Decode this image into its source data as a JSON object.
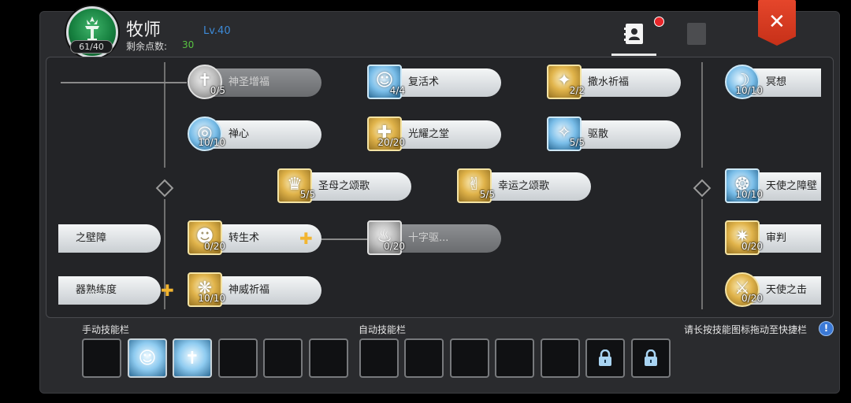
{
  "header": {
    "class_name": "牧师",
    "level": "Lv.40",
    "points_label": "剩余点数:",
    "points_value": "30",
    "avatar_badge": "61/40"
  },
  "close_label": "✕",
  "skills": [
    {
      "id": "shenshengzengfu",
      "name": "神圣增福",
      "level": "0/5",
      "style": "grey"
    },
    {
      "id": "fuhuoshu",
      "name": "复活术",
      "level": "4/4",
      "style": "blue"
    },
    {
      "id": "sashuiqifu",
      "name": "撒水祈福",
      "level": "2/2",
      "style": "gold"
    },
    {
      "id": "mingxiang",
      "name": "冥想",
      "level": "10/10",
      "style": "blue"
    },
    {
      "id": "chanxin",
      "name": "禅心",
      "level": "10/10",
      "style": "blue"
    },
    {
      "id": "guangyaozhitang",
      "name": "光耀之堂",
      "level": "20/20",
      "style": "gold"
    },
    {
      "id": "qusan",
      "name": "驱散",
      "level": "5/5",
      "style": "blue"
    },
    {
      "id": "shengmuzhisongge",
      "name": "圣母之颂歌",
      "level": "5/5",
      "style": "gold"
    },
    {
      "id": "xingyunzhisongge",
      "name": "幸运之颂歌",
      "level": "5/5",
      "style": "gold"
    },
    {
      "id": "tianshizhizhangbi",
      "name": "天使之障壁",
      "level": "10/10",
      "style": "blue"
    },
    {
      "id": "left-bizhang",
      "name": "之壁障",
      "style": "none"
    },
    {
      "id": "zhuanshengshu",
      "name": "转生术",
      "level": "0/20",
      "style": "gold"
    },
    {
      "id": "shiziqu",
      "name": "十字驱...",
      "level": "0/20",
      "style": "grey"
    },
    {
      "id": "shenpan",
      "name": "审判",
      "level": "0/20",
      "style": "gold"
    },
    {
      "id": "left-shulian",
      "name": "器熟练度",
      "style": "none"
    },
    {
      "id": "shenweiqifu",
      "name": "神威祈福",
      "level": "10/10",
      "style": "gold"
    },
    {
      "id": "tianshizhiji",
      "name": "天使之击",
      "level": "0/20",
      "style": "gold"
    }
  ],
  "manual_bar": {
    "label": "手动技能栏"
  },
  "auto_bar": {
    "label": "自动技能栏"
  },
  "hint": "请长按技能图标拖动至快捷栏",
  "hint_icon": "!",
  "colors": {
    "accent_blue": "#3d8bd9",
    "points_green": "#58c241",
    "close_red": "#d63a1f",
    "plus_gold": "#f2b531"
  }
}
